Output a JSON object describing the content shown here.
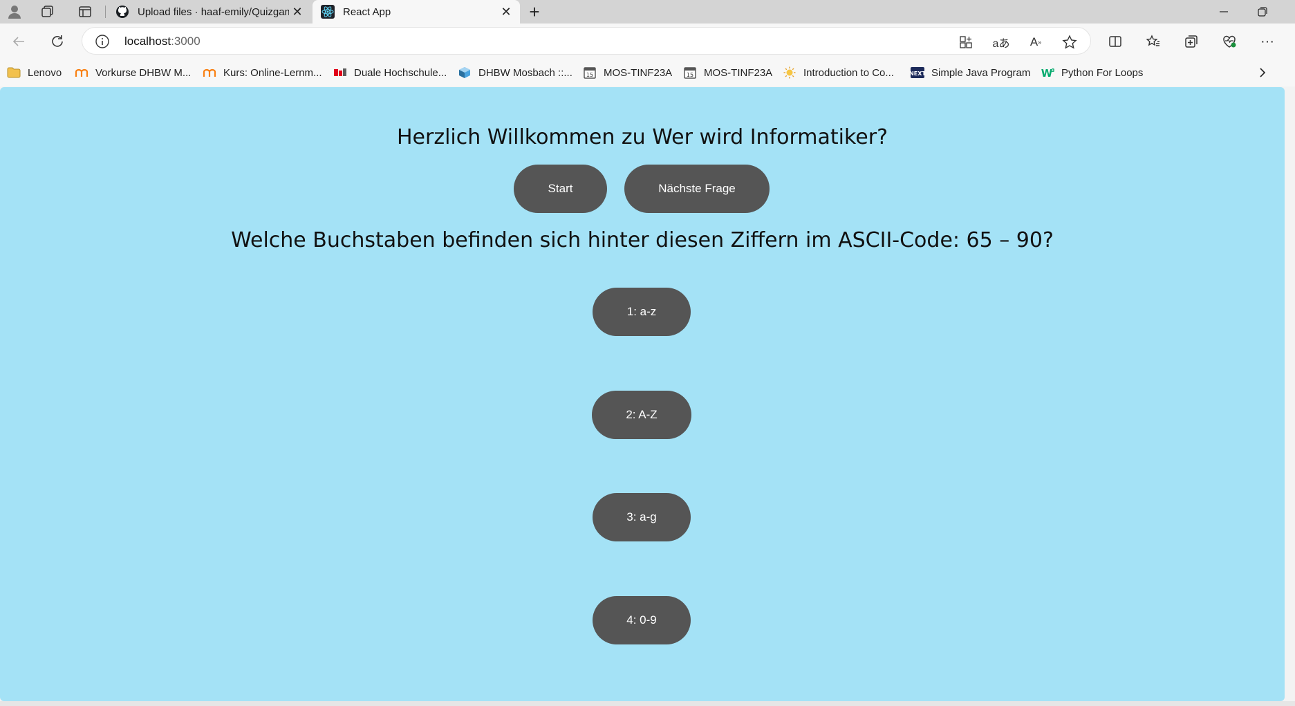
{
  "browser": {
    "tabs": [
      {
        "title": "Upload files · haaf-emily/Quizgame",
        "favicon": "github-icon",
        "active": false
      },
      {
        "title": "React App",
        "favicon": "react-icon",
        "active": true
      }
    ],
    "address": {
      "host": "localhost",
      "port": ":3000"
    },
    "bookmarks": [
      {
        "label": "Lenovo",
        "icon": "folder-icon"
      },
      {
        "label": "Vorkurse DHBW M...",
        "icon": "moodle-icon"
      },
      {
        "label": "Kurs: Online-Lernm...",
        "icon": "moodle-icon"
      },
      {
        "label": "Duale Hochschule...",
        "icon": "dhbw-icon"
      },
      {
        "label": "DHBW Mosbach ::...",
        "icon": "dhbw-cube-icon"
      },
      {
        "label": "MOS-TINF23A",
        "icon": "calendar-icon"
      },
      {
        "label": "MOS-TINF23A",
        "icon": "calendar-icon"
      },
      {
        "label": "Introduction to Co...",
        "icon": "sun-icon"
      },
      {
        "label": "Simple Java Program",
        "icon": "next-icon"
      },
      {
        "label": "Python For Loops",
        "icon": "w3schools-icon"
      }
    ]
  },
  "app": {
    "heading": "Herzlich Willkommen zu Wer wird Informatiker?",
    "start_label": "Start",
    "next_label": "Nächste Frage",
    "question": "Welche Buchstaben befinden sich hinter diesen Ziffern im ASCII-Code: 65 – 90?",
    "answers": [
      "1: a-z",
      "2: A-Z",
      "3: a-g",
      "4: 0-9"
    ]
  },
  "colors": {
    "page_background": "#a4e2f6",
    "button_background": "#555555",
    "button_text": "#ffffff"
  }
}
